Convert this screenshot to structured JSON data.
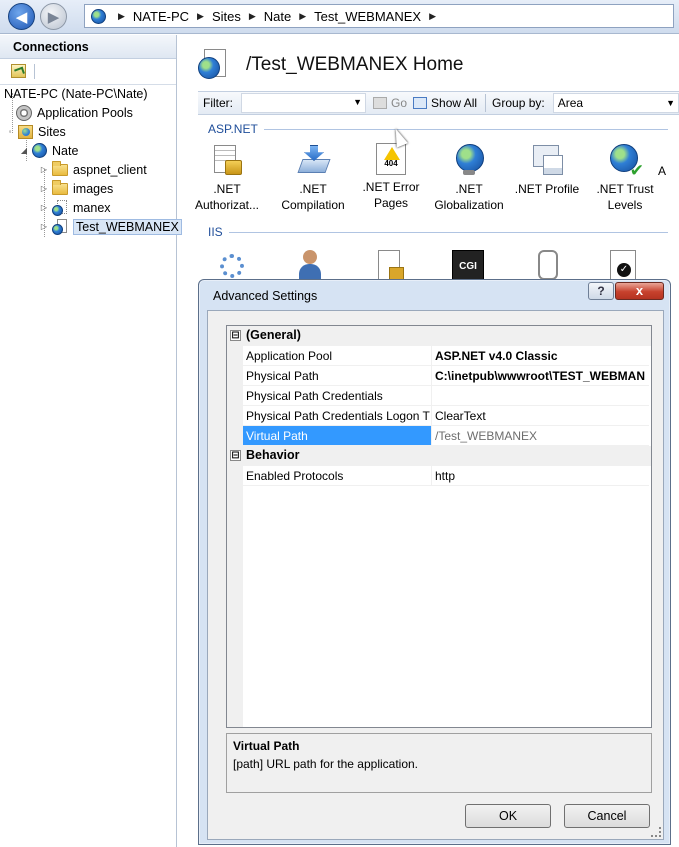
{
  "address_bar": {
    "breadcrumbs": [
      "NATE-PC",
      "Sites",
      "Nate",
      "Test_WEBMANEX"
    ]
  },
  "connections": {
    "title": "Connections",
    "tree": [
      {
        "label": "NATE-PC (Nate-PC\\Nate)",
        "icon": "server-icon"
      },
      {
        "label": "Application Pools",
        "icon": "app-pool-icon"
      },
      {
        "label": "Sites",
        "icon": "sites-folder-icon"
      },
      {
        "label": "Nate",
        "icon": "globe-icon"
      },
      {
        "label": "aspnet_client",
        "icon": "folder-icon"
      },
      {
        "label": "images",
        "icon": "folder-icon"
      },
      {
        "label": "manex",
        "icon": "web-app-icon"
      },
      {
        "label": "Test_WEBMANEX",
        "icon": "web-app-icon",
        "selected": true
      }
    ]
  },
  "home": {
    "title": "/Test_WEBMANEX Home"
  },
  "filter_bar": {
    "filter_label": "Filter:",
    "go_label": "Go",
    "show_all_label": "Show All",
    "group_by_label": "Group by:",
    "group_by_value": "Area"
  },
  "aspnet_section": {
    "title": "ASP.NET",
    "features": [
      {
        "label": ".NET\nAuthorizat...",
        "icon": "authorization-icon"
      },
      {
        "label": ".NET\nCompilation",
        "icon": "compilation-icon"
      },
      {
        "label": ".NET Error\nPages",
        "icon": "error-pages-icon",
        "code": "404"
      },
      {
        "label": ".NET\nGlobalization",
        "icon": "globalization-icon"
      },
      {
        "label": ".NET Profile",
        "icon": "profile-icon"
      },
      {
        "label": ".NET Trust\nLevels",
        "icon": "trust-levels-icon"
      },
      {
        "label": "A",
        "icon": "more-icon"
      }
    ]
  },
  "iis_section": {
    "title": "IIS",
    "cgi_label": "CGI"
  },
  "dialog": {
    "title": "Advanced Settings",
    "help_label": "?",
    "close_label": "x",
    "categories": [
      {
        "name": "(General)",
        "toggle": "⊟",
        "properties": [
          {
            "name": "Application Pool",
            "value": "ASP.NET v4.0 Classic",
            "style": "bold"
          },
          {
            "name": "Physical Path",
            "value": "C:\\inetpub\\wwwroot\\TEST_WEBMAN",
            "style": "bold"
          },
          {
            "name": "Physical Path Credentials",
            "value": "",
            "style": "normal"
          },
          {
            "name": "Physical Path Credentials Logon T",
            "value": "ClearText",
            "style": "normal"
          },
          {
            "name": "Virtual Path",
            "value": "/Test_WEBMANEX",
            "style": "dim",
            "selected": true
          }
        ]
      },
      {
        "name": "Behavior",
        "toggle": "⊟",
        "properties": [
          {
            "name": "Enabled Protocols",
            "value": "http",
            "style": "normal"
          }
        ]
      }
    ],
    "description": {
      "title": "Virtual Path",
      "text": "[path] URL path for the application."
    },
    "ok_label": "OK",
    "cancel_label": "Cancel"
  }
}
